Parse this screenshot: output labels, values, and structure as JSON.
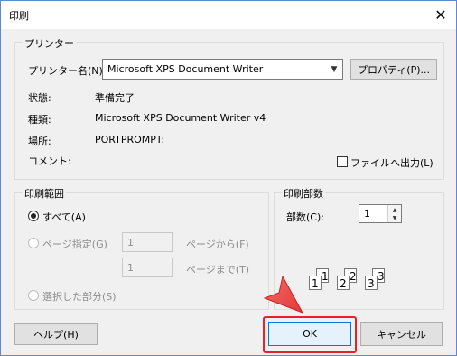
{
  "window": {
    "title": "印刷"
  },
  "printer": {
    "group_label": "プリンター",
    "name_label": "プリンター名(N):",
    "name_value": "Microsoft XPS Document Writer",
    "properties_button": "プロパティ(P)...",
    "status_label": "状態:",
    "status_value": "準備完了",
    "type_label": "種類:",
    "type_value": "Microsoft XPS Document Writer v4",
    "location_label": "場所:",
    "location_value": "PORTPROMPT:",
    "comment_label": "コメント:",
    "print_to_file_label": "ファイルへ出力(L)"
  },
  "range": {
    "group_label": "印刷範囲",
    "all_label": "すべて(A)",
    "pages_label": "ページ指定(G)",
    "from_value": "1",
    "from_label": "ページから(F)",
    "to_value": "1",
    "to_label": "ページまで(T)",
    "selection_label": "選択した部分(S)"
  },
  "copies": {
    "group_label": "印刷部数",
    "count_label": "部数(C):",
    "count_value": "1",
    "collate_pages": [
      "1",
      "1",
      "2",
      "2",
      "3",
      "3"
    ]
  },
  "buttons": {
    "help": "ヘルプ(H)",
    "ok": "OK",
    "cancel": "キャンセル"
  },
  "colors": {
    "highlight": "#e8202a",
    "cursor_arrow": "#f05a5a"
  }
}
